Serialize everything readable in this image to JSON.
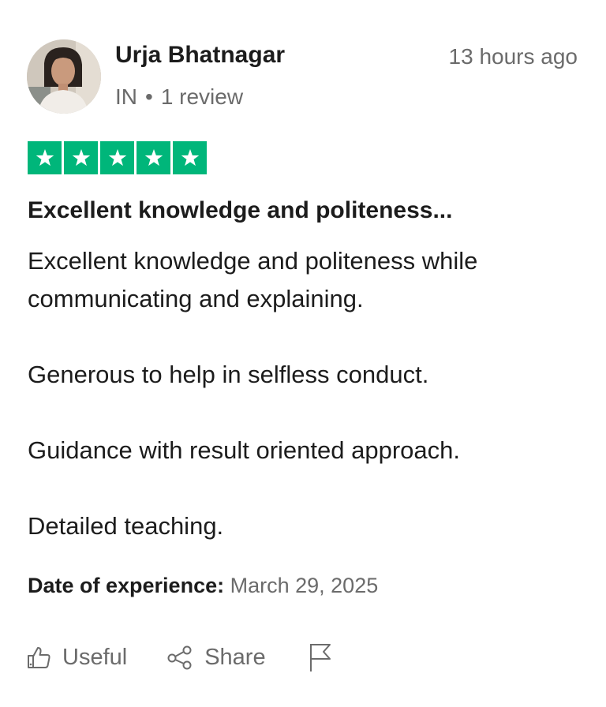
{
  "review": {
    "reviewer": {
      "name": "Urja Bhatnagar",
      "country": "IN",
      "separator": "•",
      "review_count": "1 review"
    },
    "time_ago": "13 hours ago",
    "rating": 5,
    "rating_max": 5,
    "star_color": "#00b67a",
    "title": "Excellent knowledge and politeness...",
    "body": [
      "Excellent knowledge and politeness while communicating and explaining.",
      "Generous to help in selfless conduct.",
      "Guidance with result oriented approach.",
      "Detailed teaching."
    ],
    "experience": {
      "label": "Date of experience:",
      "date": "March 29, 2025"
    }
  },
  "actions": {
    "useful_label": "Useful",
    "share_label": "Share",
    "icons": [
      "thumbs-up-icon",
      "share-icon",
      "flag-icon"
    ]
  }
}
